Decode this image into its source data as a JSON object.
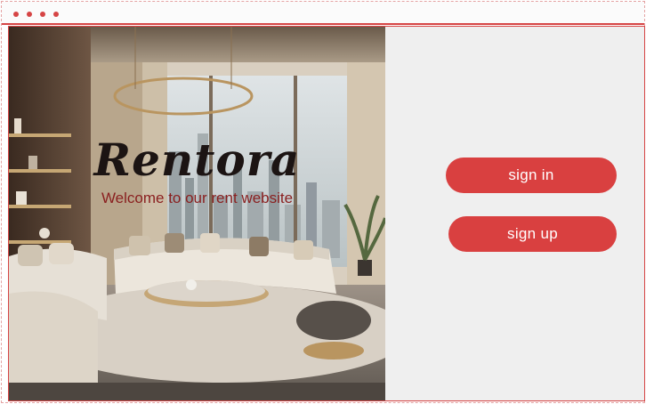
{
  "window": {
    "controls": [
      "dot",
      "dot",
      "dot",
      "dot"
    ]
  },
  "hero": {
    "brand": "Rentora",
    "tagline": "Welcome to our rent website",
    "image_icon": "living-room-photo"
  },
  "auth": {
    "sign_in_label": "sign in",
    "sign_up_label": "sign up"
  },
  "colors": {
    "accent": "#d94040",
    "border": "#d64545",
    "panel_bg": "#efefef",
    "brand_text": "#1c1413",
    "tagline_text": "#8a1f1f"
  }
}
